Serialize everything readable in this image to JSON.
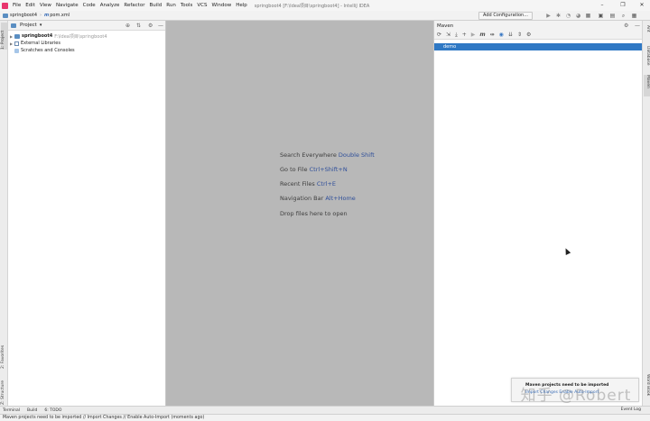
{
  "app": {
    "window_title": "springboot4 [F:\\Idea项目\\springboot4] - IntelliJ IDEA"
  },
  "menu": [
    "File",
    "Edit",
    "View",
    "Navigate",
    "Code",
    "Analyze",
    "Refactor",
    "Build",
    "Run",
    "Tools",
    "VCS",
    "Window",
    "Help"
  ],
  "window_controls": {
    "minimize": "–",
    "maximize": "❐",
    "close": "✕"
  },
  "breadcrumb": {
    "project": "springboot4",
    "file": "pom.xml",
    "separator": "›"
  },
  "toolbar": {
    "add_configuration": "Add Configuration..."
  },
  "left_strip": {
    "project_tab": "1: Project",
    "favorites_tab": "2: Favorites",
    "structure_tab": "Z: Structure"
  },
  "right_strip": {
    "ant_tab": "Ant",
    "database_tab": "Database",
    "maven_tab": "Maven",
    "word_book_tab": "Word Book"
  },
  "project_panel": {
    "title": "Project",
    "dropdown": "▾",
    "tree": [
      {
        "label": "springboot4",
        "path": "F:\\Idea项目\\springboot4"
      },
      {
        "label": "External Libraries"
      },
      {
        "label": "Scratches and Consoles"
      }
    ]
  },
  "editor": {
    "hints": [
      {
        "label": "Search Everywhere",
        "key": "Double Shift"
      },
      {
        "label": "Go to File",
        "key": "Ctrl+Shift+N"
      },
      {
        "label": "Recent Files",
        "key": "Ctrl+E"
      },
      {
        "label": "Navigation Bar",
        "key": "Alt+Home"
      },
      {
        "label": "Drop files here to open",
        "key": ""
      }
    ]
  },
  "maven_panel": {
    "title": "Maven",
    "project": "demo",
    "toolbar_glyphs": {
      "refresh": "⟳",
      "reimport": "⇲",
      "download": "⤓",
      "add": "+",
      "run": "▶",
      "m": "m",
      "toggle": "⇹",
      "offline": "◉",
      "collapse": "⇊",
      "expand": "⇕",
      "settings": "⚙"
    }
  },
  "panel_icons": {
    "globe": "⊕",
    "sort": "⇅",
    "gear": "⚙",
    "hide": "—"
  },
  "bottom_tools": {
    "terminal": "Terminal",
    "build": "Build",
    "todo": "6: TODO",
    "event_log": "Event Log"
  },
  "status_bar": {
    "text": "Maven projects need to be imported // Import Changes // Enable Auto-Import (moments ago)"
  },
  "notification": {
    "title": "Maven projects need to be imported",
    "links": "Import Changes  Enable Auto-Import",
    "watermark": "知乎 @Robert"
  },
  "colors": {
    "accent": "#2f78c4",
    "editor_bg": "#b8b8b8",
    "key_hint": "#2f4f9a",
    "logo": "#e8356d"
  }
}
